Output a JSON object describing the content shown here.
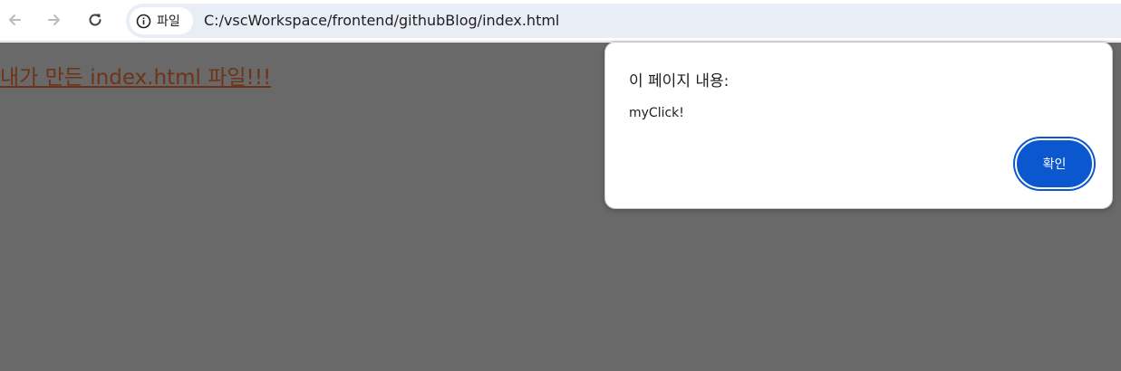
{
  "toolbar": {
    "back_icon": "back-arrow-icon",
    "forward_icon": "forward-arrow-icon",
    "reload_icon": "reload-icon",
    "site_info_icon": "info-icon",
    "site_info_label": "파일",
    "url": "C:/vscWorkspace/frontend/githubBlog/index.html"
  },
  "page": {
    "link_text": "내가 만든 index.html 파일!!!"
  },
  "dialog": {
    "title": "이 페이지 내용:",
    "message": "myClick!",
    "ok_label": "확인"
  },
  "colors": {
    "overlay": "#696969",
    "accent": "#0b57d0",
    "omnibox": "#e9eef6",
    "link": "#6d3418"
  }
}
